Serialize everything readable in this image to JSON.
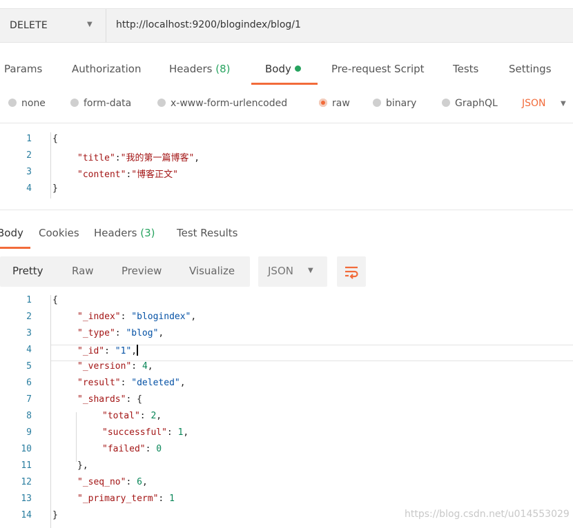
{
  "request": {
    "method": "DELETE",
    "url": "http://localhost:9200/blogindex/blog/1"
  },
  "request_tabs": {
    "params": "Params",
    "authorization": "Authorization",
    "headers_label": "Headers",
    "headers_count": "(8)",
    "body": "Body",
    "prerequest": "Pre-request Script",
    "tests": "Tests",
    "settings": "Settings"
  },
  "body_types": {
    "none": "none",
    "form_data": "form-data",
    "urlencoded": "x-www-form-urlencoded",
    "raw": "raw",
    "binary": "binary",
    "graphql": "GraphQL",
    "format": "JSON",
    "selected": "raw"
  },
  "request_body": {
    "line_numbers": [
      "1",
      "2",
      "3",
      "4"
    ],
    "open_brace": "{",
    "title_key": "\"title\"",
    "title_value": "\"我的第一篇博客\"",
    "content_key": "\"content\"",
    "content_value": "\"博客正文\"",
    "close_brace": "}"
  },
  "response_tabs": {
    "body": "Body",
    "cookies": "Cookies",
    "headers_label": "Headers",
    "headers_count": "(3)",
    "test_results": "Test Results"
  },
  "view_modes": {
    "pretty": "Pretty",
    "raw": "Raw",
    "preview": "Preview",
    "visualize": "Visualize",
    "format": "JSON"
  },
  "response_body": {
    "line_numbers": [
      "1",
      "2",
      "3",
      "4",
      "5",
      "6",
      "7",
      "8",
      "9",
      "10",
      "11",
      "12",
      "13",
      "14"
    ],
    "open_brace": "{",
    "index_key": "\"_index\"",
    "index_value": "\"blogindex\"",
    "type_key": "\"_type\"",
    "type_value": "\"blog\"",
    "id_key": "\"_id\"",
    "id_value": "\"1\"",
    "version_key": "\"_version\"",
    "version_value": "4",
    "result_key": "\"result\"",
    "result_value": "\"deleted\"",
    "shards_key": "\"_shards\"",
    "total_key": "\"total\"",
    "total_value": "2",
    "successful_key": "\"successful\"",
    "successful_value": "1",
    "failed_key": "\"failed\"",
    "failed_value": "0",
    "shards_close": "},",
    "seq_key": "\"_seq_no\"",
    "seq_value": "6",
    "primary_key": "\"_primary_term\"",
    "primary_value": "1",
    "close_brace": "}"
  },
  "watermark": "https://blog.csdn.net/u014553029",
  "colors": {
    "accent": "#f26b3a",
    "success": "#27a35f",
    "json_key": "#a31515",
    "json_string": "#0451a5",
    "json_number": "#098658"
  }
}
